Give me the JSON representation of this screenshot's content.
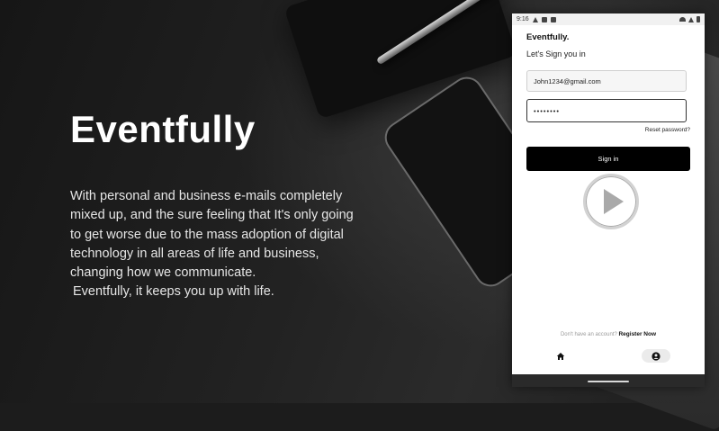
{
  "hero": {
    "title": "Eventfully",
    "description_lines": [
      "With personal and business e-mails completely",
      "mixed up, and the sure feeling that It's only going",
      "to get worse due to the mass adoption of digital",
      "technology in all areas of life and business,",
      "changing how we communicate.",
      "Eventfully, it keeps you up with life."
    ]
  },
  "device": {
    "status_time": "9:16",
    "status_icons_left": [
      "warning-icon",
      "notification-icon",
      "sd-card-icon"
    ],
    "status_icons_right": [
      "wifi-icon",
      "signal-icon",
      "battery-icon"
    ],
    "app_title": "Eventfully.",
    "subtitle": "Let's Sign you in",
    "email_value": "John1234@gmail.com",
    "password_value": "••••••••",
    "reset_label": "Reset password?",
    "signin_label": "Sign in",
    "register_question": "Don't have an account?",
    "register_link": "Register Now",
    "nav_icons": [
      "home-icon",
      "user-icon"
    ]
  },
  "colors": {
    "background": "#1c1c1c",
    "signin_button": "#000000",
    "device_bg": "#ffffff"
  }
}
